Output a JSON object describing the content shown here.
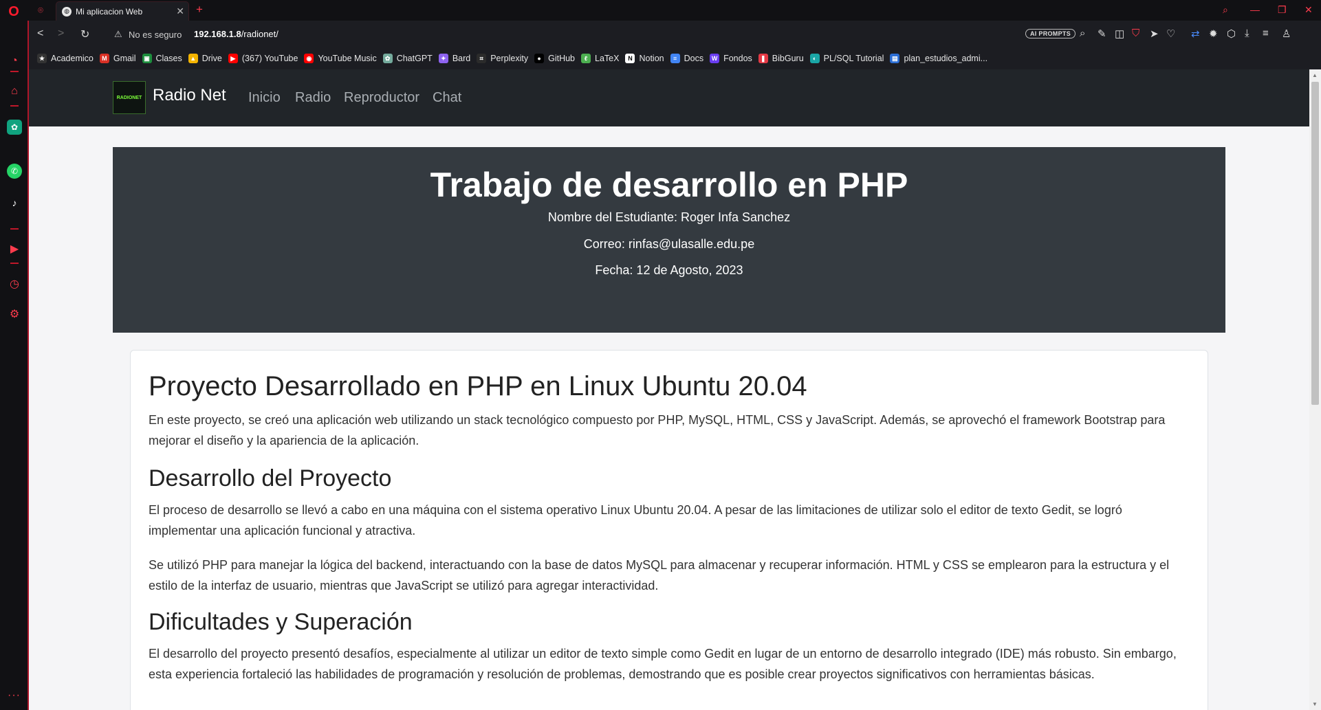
{
  "browser": {
    "tab_title": "Mi aplicacion Web",
    "security_label": "No es seguro",
    "url_host": "192.168.1.8",
    "url_path": "/radionet/",
    "ai_prompts_label": "AI PROMPTS",
    "accent": "#ff1b2d"
  },
  "bookmarks": [
    {
      "label": "Academico",
      "icon": "star-icon",
      "color": "#333"
    },
    {
      "label": "Gmail",
      "icon": "gmail-icon",
      "color": "#d93025"
    },
    {
      "label": "Clases",
      "icon": "classroom-icon",
      "color": "#1e8e3e"
    },
    {
      "label": "Drive",
      "icon": "drive-icon",
      "color": "#f4b400"
    },
    {
      "label": "(367) YouTube",
      "icon": "youtube-icon",
      "color": "#ff0000"
    },
    {
      "label": "YouTube Music",
      "icon": "youtube-music-icon",
      "color": "#ff0000"
    },
    {
      "label": "ChatGPT",
      "icon": "chatgpt-icon",
      "color": "#74aa9c"
    },
    {
      "label": "Bard",
      "icon": "bard-icon",
      "color": "#8e63f0"
    },
    {
      "label": "Perplexity",
      "icon": "perplexity-icon",
      "color": "#2b2b2b"
    },
    {
      "label": "GitHub",
      "icon": "github-icon",
      "color": "#000"
    },
    {
      "label": "LaTeX",
      "icon": "latex-icon",
      "color": "#4caf50"
    },
    {
      "label": "Notion",
      "icon": "notion-icon",
      "color": "#fff"
    },
    {
      "label": "Docs",
      "icon": "docs-icon",
      "color": "#4285f4"
    },
    {
      "label": "Fondos",
      "icon": "wallpaper-icon",
      "color": "#6a3df0"
    },
    {
      "label": "BibGuru",
      "icon": "bibguru-icon",
      "color": "#e53945"
    },
    {
      "label": "PL/SQL Tutorial",
      "icon": "plsql-icon",
      "color": "#1aa6a6"
    },
    {
      "label": "plan_estudios_admi...",
      "icon": "document-icon",
      "color": "#2c6ed5"
    }
  ],
  "site": {
    "brand": "Radio Net",
    "logo_text": "RADIONET",
    "nav": [
      "Inicio",
      "Radio",
      "Reproductor",
      "Chat"
    ],
    "hero": {
      "title": "Trabajo de desarrollo en PHP",
      "student": "Nombre del Estudiante: Roger Infa Sanchez",
      "email": "Correo: rinfas@ulasalle.edu.pe",
      "date": "Fecha: 12 de Agosto, 2023"
    },
    "content": {
      "h1": "Proyecto Desarrollado en PHP en Linux Ubuntu 20.04",
      "p1": "En este proyecto, se creó una aplicación web utilizando un stack tecnológico compuesto por PHP, MySQL, HTML, CSS y JavaScript. Además, se aprovechó el framework Bootstrap para mejorar el diseño y la apariencia de la aplicación.",
      "h2": "Desarrollo del Proyecto",
      "p2": "El proceso de desarrollo se llevó a cabo en una máquina con el sistema operativo Linux Ubuntu 20.04. A pesar de las limitaciones de utilizar solo el editor de texto Gedit, se logró implementar una aplicación funcional y atractiva.",
      "p3": "Se utilizó PHP para manejar la lógica del backend, interactuando con la base de datos MySQL para almacenar y recuperar información. HTML y CSS se emplearon para la estructura y el estilo de la interfaz de usuario, mientras que JavaScript se utilizó para agregar interactividad.",
      "h3": "Dificultades y Superación",
      "p4": "El desarrollo del proyecto presentó desafíos, especialmente al utilizar un editor de texto simple como Gedit en lugar de un entorno de desarrollo integrado (IDE) más robusto. Sin embargo, esta experiencia fortaleció las habilidades de programación y resolución de problemas, demostrando que es posible crear proyectos significativos con herramientas básicas."
    }
  }
}
